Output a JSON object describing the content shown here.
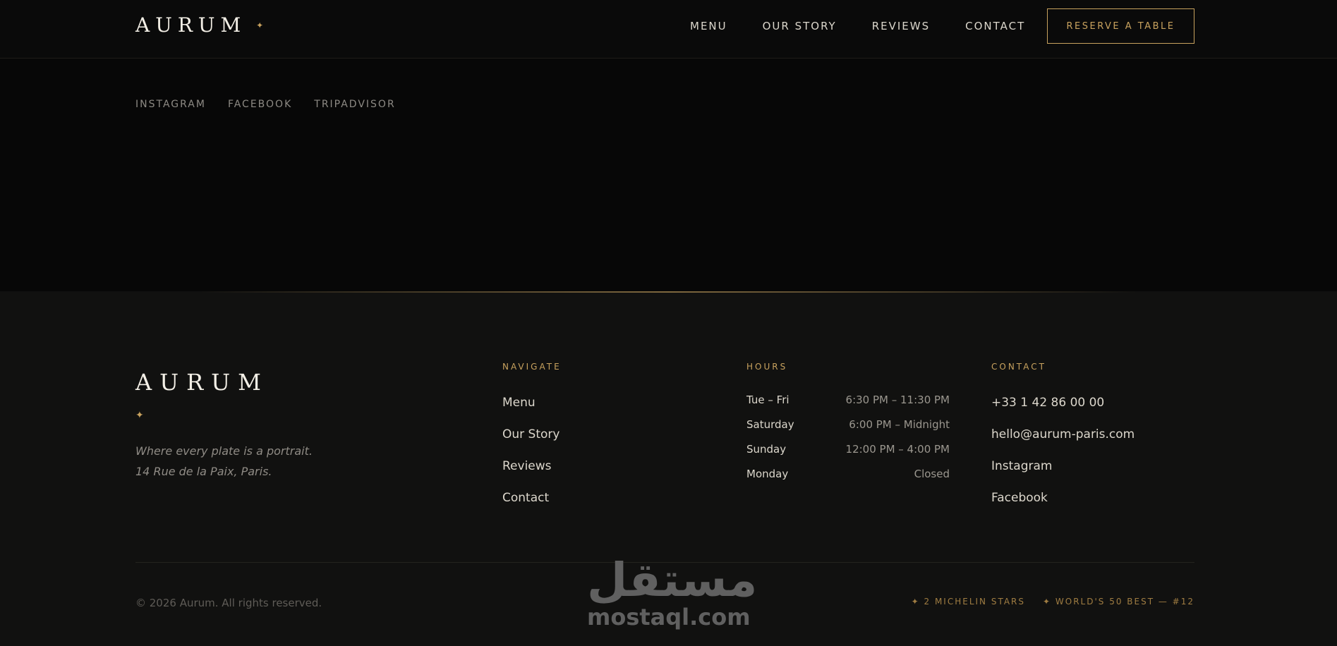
{
  "header": {
    "logo": "AURUM",
    "logo_mark": "✦",
    "nav": [
      "MENU",
      "OUR STORY",
      "REVIEWS",
      "CONTACT"
    ],
    "reserve_label": "RESERVE A TABLE"
  },
  "social": [
    "INSTAGRAM",
    "FACEBOOK",
    "TRIPADVISOR"
  ],
  "footer": {
    "logo": "AURUM",
    "logo_mark": "✦",
    "tagline_1": "Where every plate is a portrait.",
    "tagline_2": "14 Rue de la Paix, Paris.",
    "navigate": {
      "title": "NAVIGATE",
      "links": [
        "Menu",
        "Our Story",
        "Reviews",
        "Contact"
      ]
    },
    "hours": {
      "title": "HOURS",
      "rows": [
        {
          "day": "Tue – Fri",
          "time": "6:30 PM – 11:30 PM"
        },
        {
          "day": "Saturday",
          "time": "6:00 PM – Midnight"
        },
        {
          "day": "Sunday",
          "time": "12:00 PM – 4:00 PM"
        },
        {
          "day": "Monday",
          "time": "Closed"
        }
      ]
    },
    "contact": {
      "title": "CONTACT",
      "phone": "+33 1 42 86 00 00",
      "email": "hello@aurum-paris.com",
      "links": [
        "Instagram",
        "Facebook"
      ]
    },
    "copyright": "© 2026 Aurum. All rights reserved.",
    "awards": [
      "✦ 2 MICHELIN STARS",
      "✦ WORLD'S 50 BEST — #12"
    ]
  },
  "watermark": {
    "arabic": "مستقل",
    "latin": "mostaql.com"
  },
  "colors": {
    "accent": "#c8a25e",
    "background": "#070707",
    "footer_bg": "#111110"
  }
}
